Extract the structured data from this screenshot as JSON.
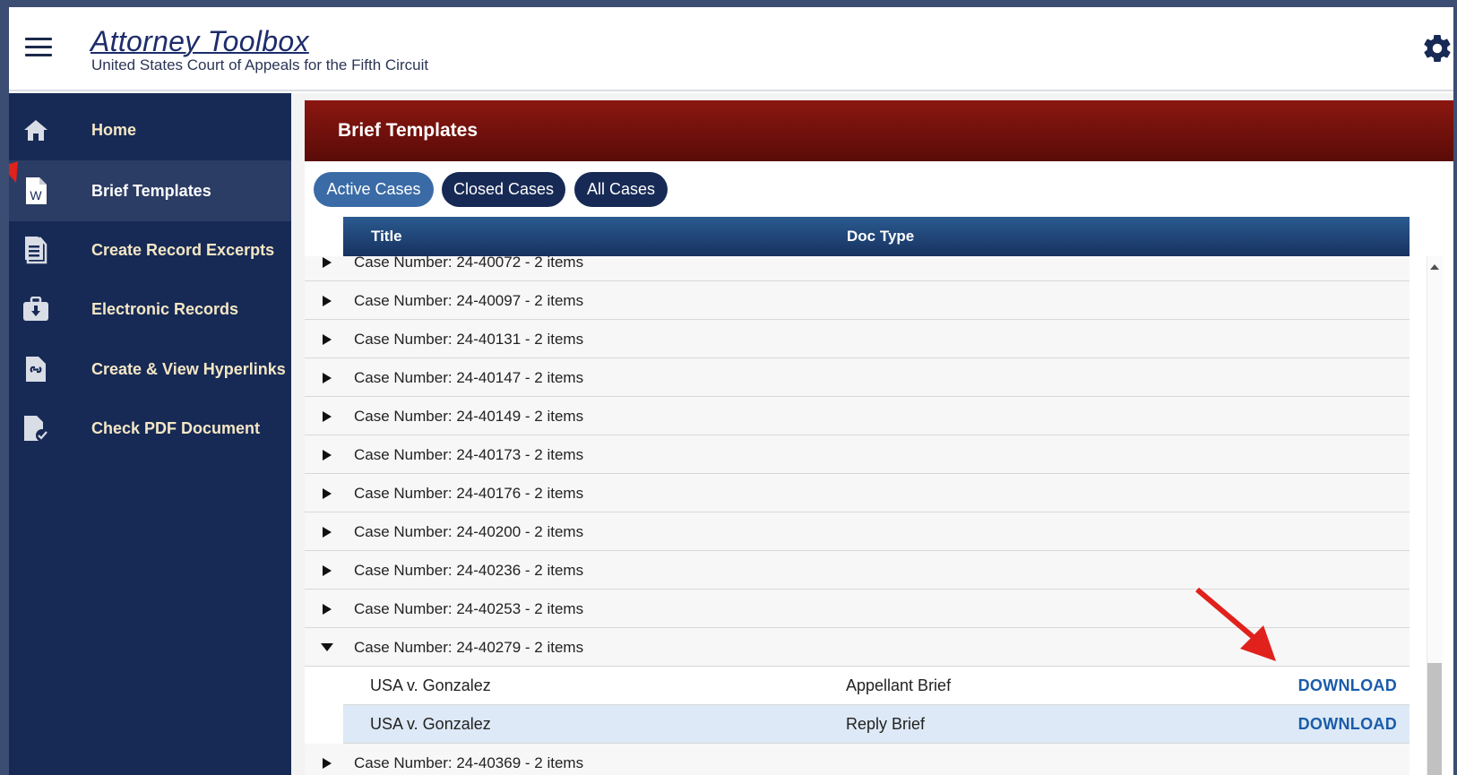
{
  "header": {
    "title": "Attorney Toolbox",
    "subtitle": "United States Court of Appeals for the Fifth Circuit"
  },
  "sidebar": {
    "items": [
      {
        "label": "Home",
        "icon": "home-icon"
      },
      {
        "label": "Brief Templates",
        "icon": "word-file-icon",
        "active": true
      },
      {
        "label": "Create Record Excerpts",
        "icon": "document-lines-icon"
      },
      {
        "label": "Electronic Records",
        "icon": "briefcase-download-icon"
      },
      {
        "label": "Create & View Hyperlinks",
        "icon": "file-link-icon"
      },
      {
        "label": "Check PDF Document",
        "icon": "file-check-icon"
      }
    ]
  },
  "panel": {
    "title": "Brief Templates",
    "tabs": [
      {
        "label": "Active Cases",
        "active": true
      },
      {
        "label": "Closed Cases"
      },
      {
        "label": "All Cases"
      }
    ],
    "columns": {
      "title": "Title",
      "doc_type": "Doc Type"
    },
    "groups": [
      {
        "label": "Case Number: 24-40072 - 2 items",
        "expanded": false
      },
      {
        "label": "Case Number: 24-40097 - 2 items",
        "expanded": false
      },
      {
        "label": "Case Number: 24-40131 - 2 items",
        "expanded": false
      },
      {
        "label": "Case Number: 24-40147 - 2 items",
        "expanded": false
      },
      {
        "label": "Case Number: 24-40149 - 2 items",
        "expanded": false
      },
      {
        "label": "Case Number: 24-40173 - 2 items",
        "expanded": false
      },
      {
        "label": "Case Number: 24-40176 - 2 items",
        "expanded": false
      },
      {
        "label": "Case Number: 24-40200 - 2 items",
        "expanded": false
      },
      {
        "label": "Case Number: 24-40236 - 2 items",
        "expanded": false
      },
      {
        "label": "Case Number: 24-40253 - 2 items",
        "expanded": false
      },
      {
        "label": "Case Number: 24-40279 - 2 items",
        "expanded": true,
        "children": [
          {
            "title": "USA v. Gonzalez",
            "doc_type": "Appellant Brief",
            "action": "DOWNLOAD"
          },
          {
            "title": "USA v. Gonzalez",
            "doc_type": "Reply Brief",
            "action": "DOWNLOAD",
            "selected": true
          }
        ]
      },
      {
        "label": "Case Number: 24-40369 - 2 items",
        "expanded": false
      }
    ]
  },
  "colors": {
    "sidebar_bg": "#172a55",
    "sidebar_text": "#f4e7c5",
    "panel_header": "#7a130d",
    "grid_header": "#1f4478",
    "link": "#1a5cab",
    "annotation": "#e0211c"
  }
}
